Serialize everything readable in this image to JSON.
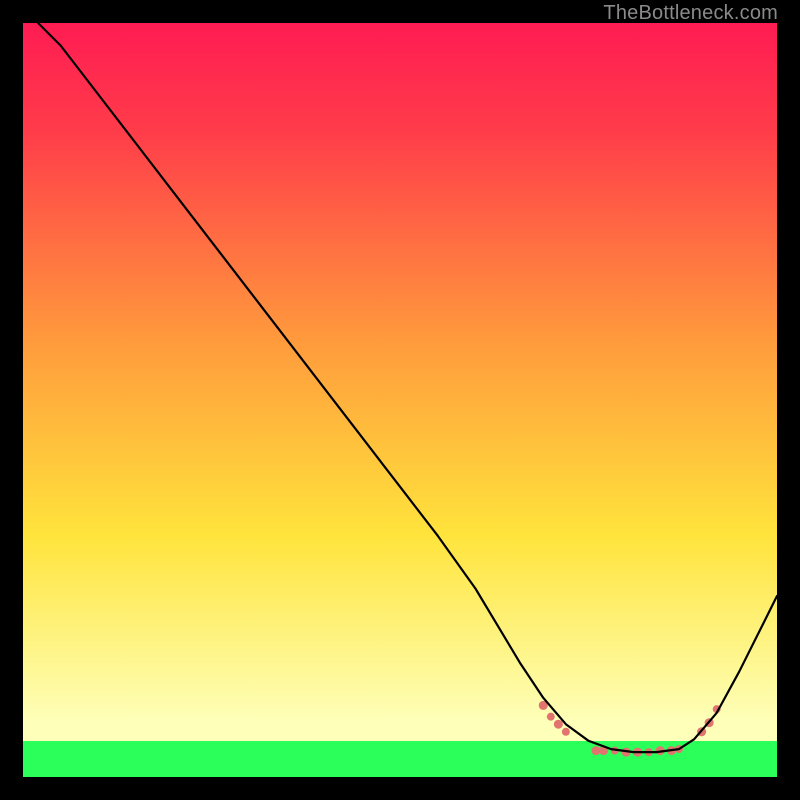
{
  "watermark": "TheBottleneck.com",
  "colors": {
    "top": "#ff1c53",
    "red": "#ff3b4a",
    "orange": "#ff9a3c",
    "yellow": "#ffe43c",
    "pale": "#feffb8",
    "green": "#2bff5a",
    "marker": "#e2746f"
  },
  "chart_data": {
    "type": "line",
    "title": "",
    "xlabel": "",
    "ylabel": "",
    "xlim": [
      0,
      100
    ],
    "ylim": [
      0,
      100
    ],
    "grid": false,
    "legend": false,
    "series": [
      {
        "name": "bottleneck-curve",
        "x": [
          2,
          5,
          10,
          15,
          20,
          25,
          30,
          35,
          40,
          45,
          50,
          55,
          60,
          63,
          66,
          69,
          72,
          75,
          78,
          81,
          84,
          87,
          89,
          92,
          95,
          98,
          100
        ],
        "y": [
          100,
          97,
          90.5,
          84,
          77.5,
          71,
          64.5,
          58,
          51.5,
          45,
          38.5,
          32,
          25,
          20,
          15,
          10.5,
          7,
          4.8,
          3.7,
          3.3,
          3.3,
          3.7,
          5,
          8.5,
          14,
          20,
          24
        ]
      }
    ],
    "markers": {
      "name": "highlight-cluster",
      "points": [
        {
          "x": 69,
          "y": 9.5,
          "r": 4.5
        },
        {
          "x": 70,
          "y": 8,
          "r": 4
        },
        {
          "x": 71,
          "y": 7,
          "r": 4.5
        },
        {
          "x": 72,
          "y": 6,
          "r": 4
        },
        {
          "x": 76,
          "y": 3.5,
          "r": 4.5
        },
        {
          "x": 77,
          "y": 3.5,
          "r": 4.5
        },
        {
          "x": 78.5,
          "y": 3.5,
          "r": 4
        },
        {
          "x": 80,
          "y": 3.3,
          "r": 4.5
        },
        {
          "x": 81.5,
          "y": 3.3,
          "r": 4.5
        },
        {
          "x": 83,
          "y": 3.3,
          "r": 4
        },
        {
          "x": 84.5,
          "y": 3.5,
          "r": 4.5
        },
        {
          "x": 86,
          "y": 3.5,
          "r": 4.5
        },
        {
          "x": 87,
          "y": 3.7,
          "r": 4
        },
        {
          "x": 90,
          "y": 6,
          "r": 4.5
        },
        {
          "x": 91,
          "y": 7.2,
          "r": 4.5
        },
        {
          "x": 92,
          "y": 9,
          "r": 4
        }
      ]
    }
  }
}
